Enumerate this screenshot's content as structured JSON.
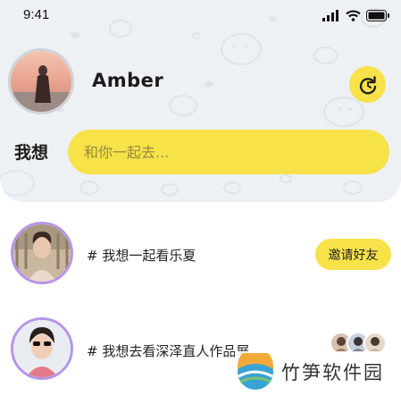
{
  "status_bar": {
    "time": "9:41"
  },
  "profile": {
    "name": "Amber"
  },
  "wish": {
    "label": "我想",
    "placeholder": "和你一起去..."
  },
  "list": [
    {
      "text": "# 我想一起看乐夏",
      "action_label": "邀请好友"
    },
    {
      "text": "# 我想去看深泽直人作品展"
    }
  ],
  "watermark": {
    "text": "竹笋软件园"
  },
  "colors": {
    "accent": "#f7e24a",
    "hero_bg": "#eef1f4",
    "ring": "#b695e8"
  }
}
